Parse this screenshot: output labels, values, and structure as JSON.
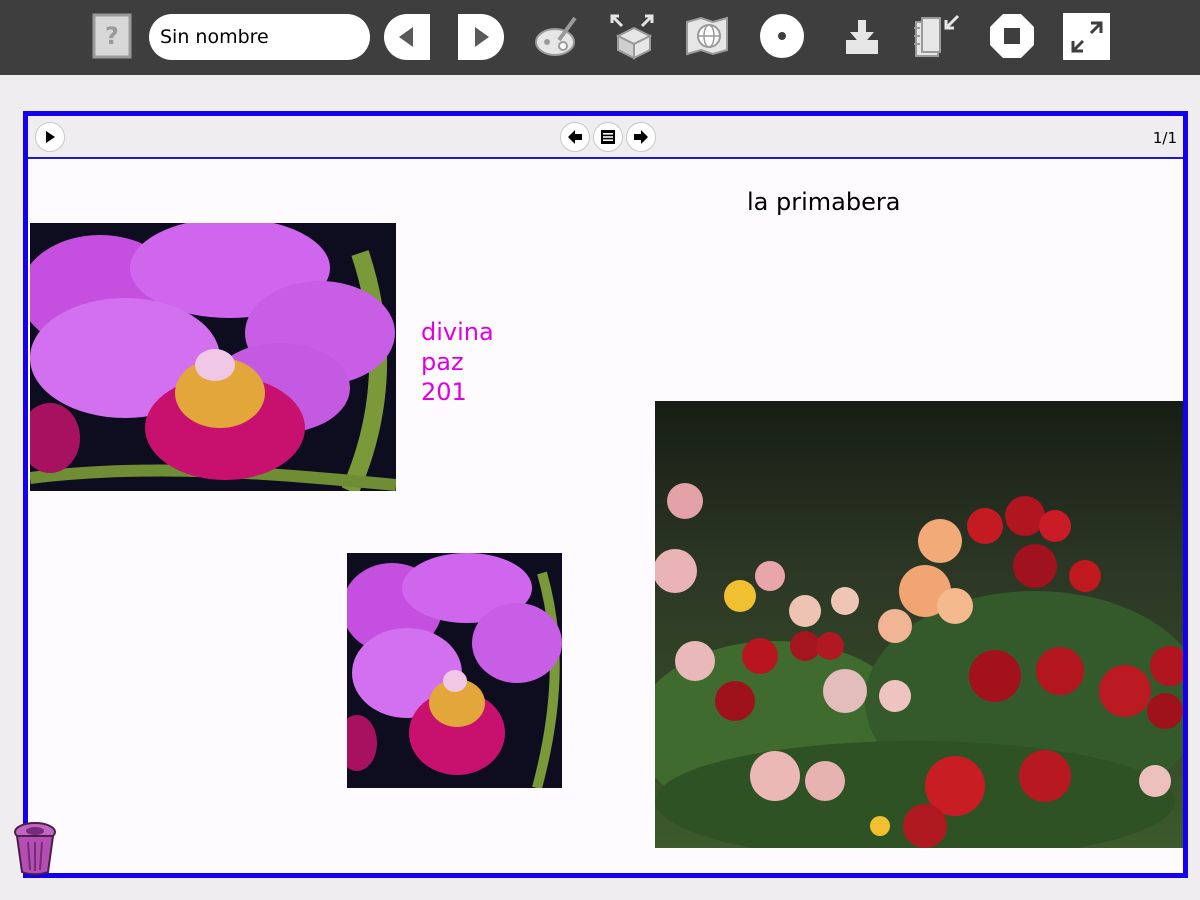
{
  "toolbar": {
    "title_value": "Sin nombre",
    "buttons": [
      {
        "name": "help-icon"
      },
      {
        "name": "back-icon"
      },
      {
        "name": "forward-icon"
      },
      {
        "name": "paint-icon"
      },
      {
        "name": "box-expand-icon"
      },
      {
        "name": "web-map-icon"
      },
      {
        "name": "record-icon"
      },
      {
        "name": "download-icon"
      },
      {
        "name": "journal-icon"
      },
      {
        "name": "stop-icon"
      },
      {
        "name": "fullscreen-icon"
      }
    ]
  },
  "document": {
    "page_indicator": "1/1",
    "caption": "la primabera",
    "pink_text": [
      "divina",
      "paz",
      "201"
    ],
    "images": [
      {
        "name": "orchid-image-large",
        "subject": "pink orchid"
      },
      {
        "name": "orchid-image-small",
        "subject": "pink orchid"
      },
      {
        "name": "roses-image",
        "subject": "garden roses"
      }
    ]
  },
  "colors": {
    "toolbar_bg": "#3e3e3e",
    "frame_border": "#1200ee",
    "pink_text": "#e000e0",
    "trash": "#b34fb3"
  }
}
